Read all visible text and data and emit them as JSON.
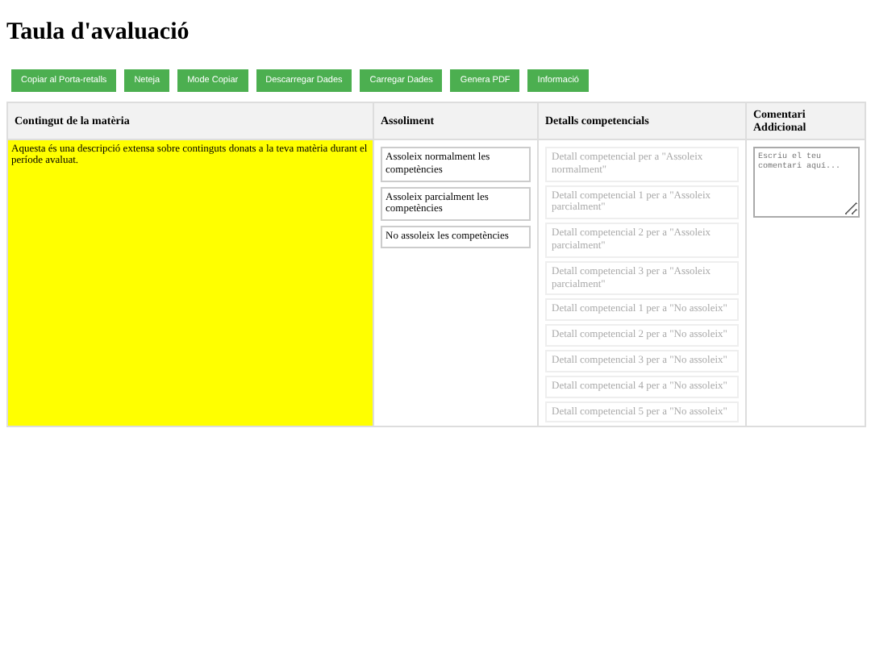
{
  "title": "Taula d'avaluació",
  "toolbar": [
    "Copiar al Porta-retalls",
    "Neteja",
    "Mode Copiar",
    "Descarregar Dades",
    "Carregar Dades",
    "Genera PDF",
    "Informació"
  ],
  "table": {
    "columns": [
      "Contingut de la matèria",
      "Assoliment",
      "Detalls competencials",
      "Comentari Addicional"
    ],
    "content": {
      "text": "Aquesta és una descripció extensa sobre continguts donats a la teva matèria durant el període avaluat.",
      "highlighted": true
    },
    "assoliment": [
      "Assoleix normalment les competències",
      "Assoleix parcialment les competències",
      "No assoleix les competències"
    ],
    "details": [
      {
        "text": "Detall competencial per a \"Assoleix normalment\"",
        "disabled": true
      },
      {
        "text": "Detall competencial 1 per a \"Assoleix parcialment\"",
        "disabled": true
      },
      {
        "text": "Detall competencial 2 per a \"Assoleix parcialment\"",
        "disabled": true
      },
      {
        "text": "Detall competencial 3 per a \"Assoleix parcialment\"",
        "disabled": true
      },
      {
        "text": "Detall competencial 1 per a \"No assoleix\"",
        "disabled": true
      },
      {
        "text": "Detall competencial 2 per a \"No assoleix\"",
        "disabled": true
      },
      {
        "text": "Detall competencial 3 per a \"No assoleix\"",
        "disabled": true
      },
      {
        "text": "Detall competencial 4 per a \"No assoleix\"",
        "disabled": true
      },
      {
        "text": "Detall competencial 5 per a \"No assoleix\"",
        "disabled": true
      }
    ],
    "comment": {
      "placeholder": "Escriu el teu comentari aquí..."
    }
  }
}
